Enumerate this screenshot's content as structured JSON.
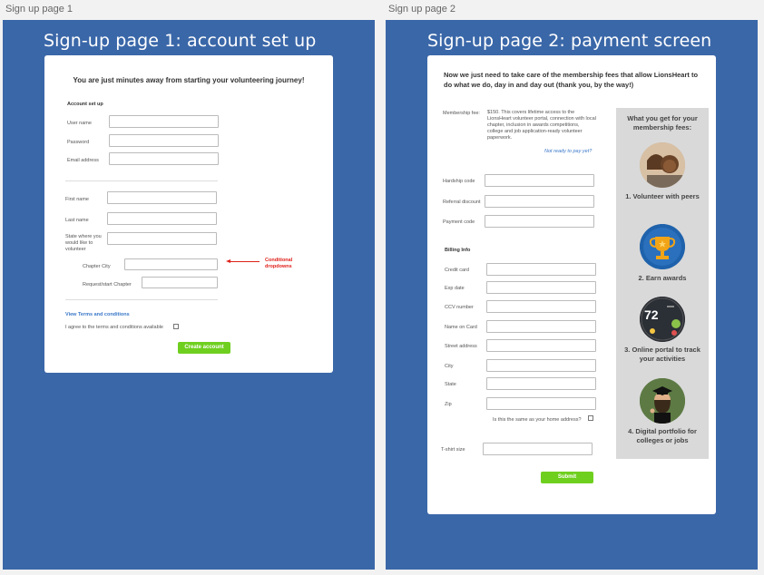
{
  "artboards": {
    "page1_label": "Sign up page 1",
    "page2_label": "Sign up page 2"
  },
  "page1": {
    "title": "Sign-up page 1: account set up",
    "heading": "You are just minutes away from starting your volunteering journey!",
    "section_account": "Account set up",
    "user_name": "User name",
    "password": "Password",
    "email": "Email address",
    "first_name": "First name",
    "last_name": "Last name",
    "state_label": "State where you would like to volunteer",
    "chapter_city": "Chapter City",
    "request_chapter": "Request/start Chapter",
    "conditional_note": "Conditional dropdowns",
    "view_terms": "View Terms and conditions",
    "agree_terms": "I agree to the terms and conditions available",
    "create_button": "Create account"
  },
  "page2": {
    "title": "Sign-up page 2: payment screen",
    "heading": "Now we just need to take care of the membership fees that allow LionsHeart to do what we do, day in and day out (thank you, by the way!)",
    "membership_fee_label": "Membership fee:",
    "membership_fee_text": "$150. This covers lifetime access to the LionsHeart volunteer portal, connection with local chapter, inclusion in awards competitions, college and job application-ready volunteer paperwork.",
    "not_ready_link": "Not ready to pay yet?",
    "hardship_code": "Hardship code",
    "referral_discount": "Referral discount",
    "payment_code": "Payment code",
    "billing_info": "Billing Info",
    "credit_card": "Credit card",
    "exp_date": "Exp date",
    "ccv_number": "CCV number",
    "name_on_card": "Name on Card",
    "street_address": "Street address",
    "city": "City",
    "state": "State",
    "zip": "Zip",
    "same_home": "Is this the same as your home address?",
    "tshirt": "T-shirt size",
    "submit_button": "Submit",
    "benefits": {
      "title": "What you get for your membership fees:",
      "b1": "1. Volunteer with peers",
      "b2": "2. Earn awards",
      "b3": "3. Online portal to track your activities",
      "b4": "4. Digital portfolio for colleges or jobs",
      "portal_number": "72"
    }
  },
  "colors": {
    "artboard": "#3a67a8",
    "button": "#6fcf1f",
    "link": "#3a78c8",
    "annotation": "#e0201a",
    "benefits_panel": "#d9d9d9"
  }
}
